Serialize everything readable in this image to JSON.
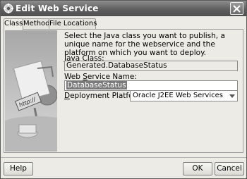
{
  "window": {
    "title": "Edit Web Service"
  },
  "tabs": [
    {
      "label": "Class",
      "active": true
    },
    {
      "label": "Methods",
      "active": false
    },
    {
      "label": "File Locations",
      "active": false
    }
  ],
  "content": {
    "description": "Select the Java class you want to publish, a unique name for the webservice and the platform on which you want to deploy.",
    "java_class": {
      "label": "Java Class:",
      "value": "Generated.DatabaseStatus"
    },
    "web_service_name": {
      "label": "Web Service Name:",
      "value": "DatabaseStatus"
    },
    "deployment_platform": {
      "label": "Deployment Platform:",
      "value": "Oracle J2EE Web Services"
    }
  },
  "buttons": {
    "help": "Help",
    "ok": "OK",
    "cancel": "Cancel"
  },
  "art": {
    "sign_text": "http://"
  }
}
